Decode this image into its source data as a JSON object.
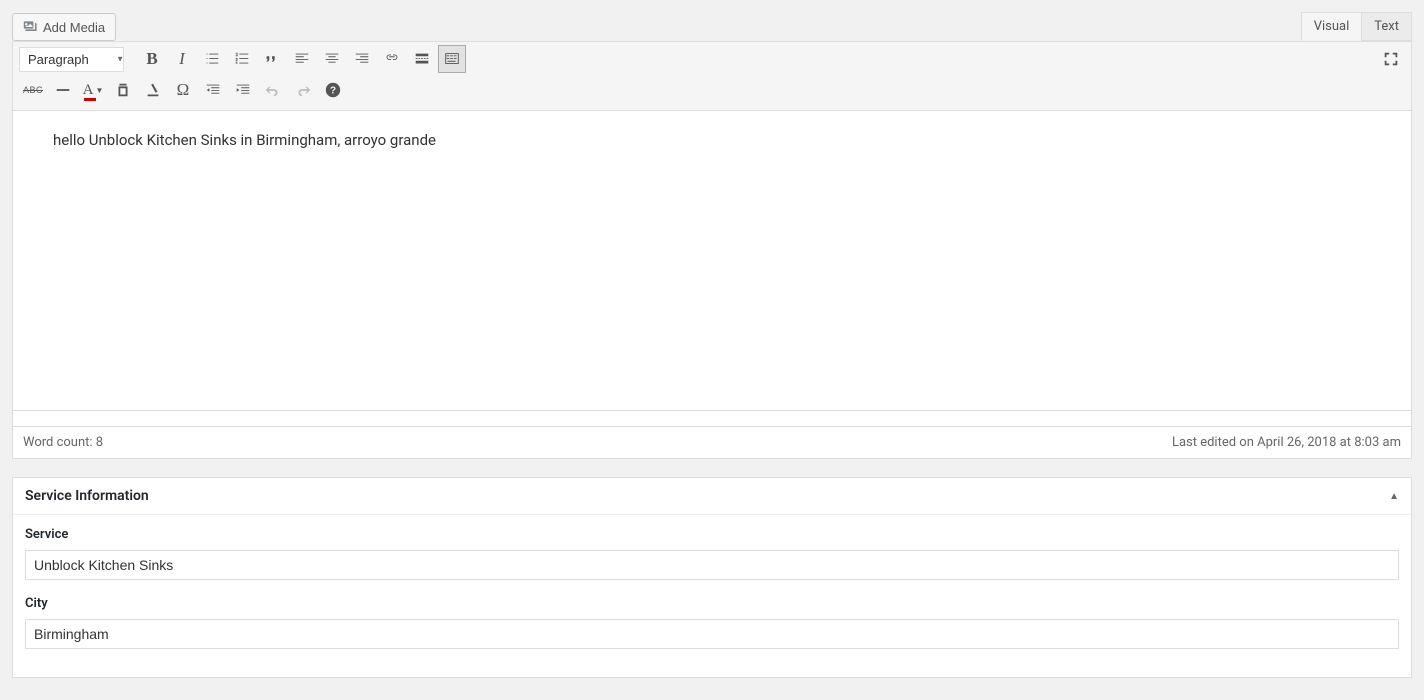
{
  "buttons": {
    "add_media": "Add Media"
  },
  "tabs": {
    "visual": "Visual",
    "text": "Text"
  },
  "format_selector": "Paragraph",
  "editor_content": "hello Unblock Kitchen Sinks in Birmingham, arroyo grande",
  "status": {
    "word_count_label": "Word count: ",
    "word_count_value": "8",
    "last_edited": "Last edited on April 26, 2018 at 8:03 am"
  },
  "metabox": {
    "title": "Service Information",
    "fields": {
      "service": {
        "label": "Service",
        "value": "Unblock Kitchen Sinks"
      },
      "city": {
        "label": "City",
        "value": "Birmingham"
      }
    }
  }
}
